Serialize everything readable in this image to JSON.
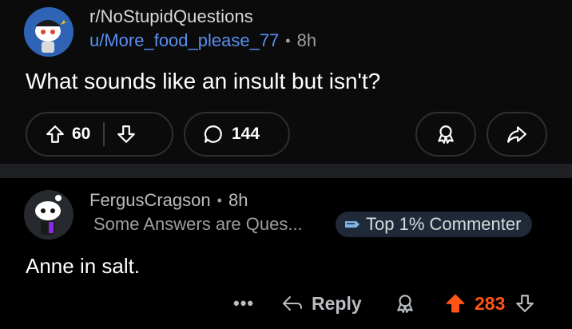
{
  "post": {
    "subreddit": "r/NoStupidQuestions",
    "author": "u/More_food_please_77",
    "time": "8h",
    "title": "What sounds like an insult but isn't?",
    "votes": "60",
    "comments": "144"
  },
  "comment": {
    "author": "FergusCragson",
    "time": "8h",
    "flair": "Some Answers are Ques...",
    "badge": "Top 1% Commenter",
    "body": "Anne in salt.",
    "more": "•••",
    "reply_label": "Reply",
    "score": "283"
  },
  "colors": {
    "background": "#000000",
    "link_blue": "#5a8ff2",
    "upvote_orange": "#ff5414",
    "muted": "#9b9fa3"
  },
  "icons": [
    "snoo-avatar",
    "upvote-icon",
    "downvote-icon",
    "comment-bubble-icon",
    "award-icon",
    "share-icon",
    "reply-arrow-icon",
    "badge-icon"
  ]
}
